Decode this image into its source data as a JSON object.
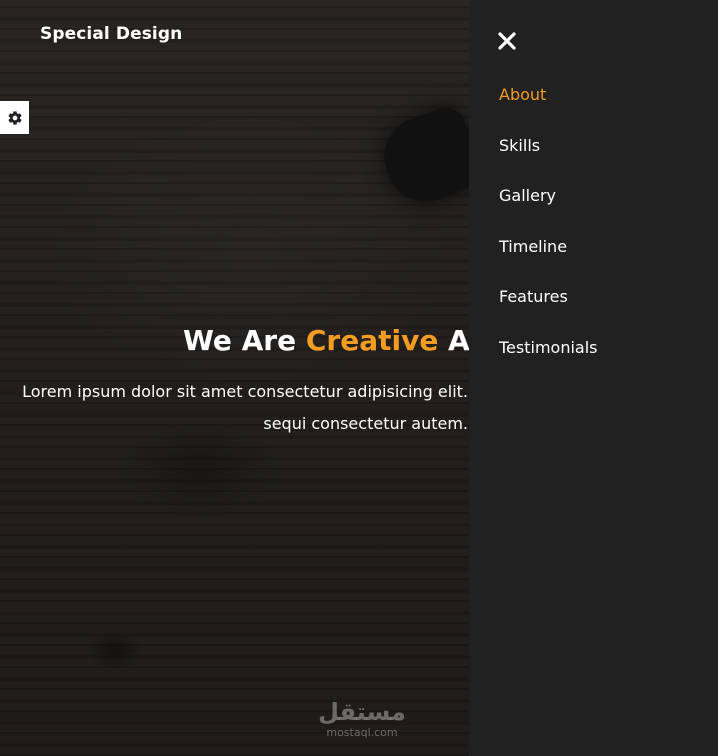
{
  "header": {
    "logo": "Special Design"
  },
  "settings": {
    "icon": "gear-icon"
  },
  "hero": {
    "title_prefix": "We Are ",
    "title_accent": "Creative",
    "title_suffix": " Ag",
    "text": "Lorem ipsum dolor sit amet consectetur adipisicing elit. sequi consectetur autem."
  },
  "nav": {
    "close_icon": "close-icon",
    "items": [
      {
        "label": "About",
        "active": true
      },
      {
        "label": "Skills",
        "active": false
      },
      {
        "label": "Gallery",
        "active": false
      },
      {
        "label": "Timeline",
        "active": false
      },
      {
        "label": "Features",
        "active": false
      },
      {
        "label": "Testimonials",
        "active": false
      }
    ]
  },
  "watermark": {
    "logo": "مستقل",
    "text": "mostaql.com"
  },
  "colors": {
    "accent": "#f39c21",
    "panel": "#212121",
    "text": "#ffffff"
  }
}
